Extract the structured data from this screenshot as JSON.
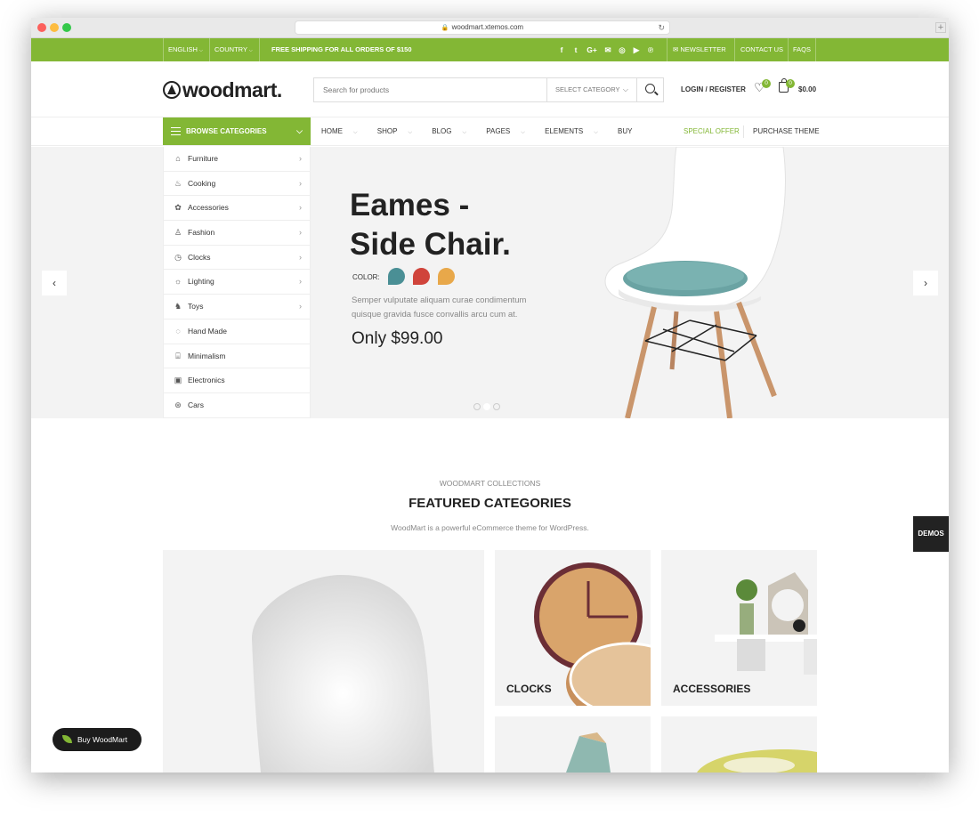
{
  "browser": {
    "url": "woodmart.xtemos.com"
  },
  "topbar": {
    "language": "ENGLISH",
    "country": "COUNTRY",
    "shipping": "FREE SHIPPING FOR ALL ORDERS OF $150",
    "socials": [
      "f",
      "t",
      "G+",
      "mail",
      "ig",
      "yt",
      "p"
    ],
    "newsletter": "NEWSLETTER",
    "contact": "CONTACT US",
    "faqs": "FAQS"
  },
  "header": {
    "logo": "woodmart.",
    "search_placeholder": "Search for products",
    "select_category": "SELECT CATEGORY",
    "login": "LOGIN / REGISTER",
    "wishlist_count": "0",
    "cart_count": "0",
    "cart_total": "$0.00"
  },
  "nav": {
    "browse": "BROWSE CATEGORIES",
    "items": [
      "HOME",
      "SHOP",
      "BLOG",
      "PAGES",
      "ELEMENTS",
      "BUY"
    ],
    "special_offer": "SPECIAL OFFER",
    "purchase": "PURCHASE THEME"
  },
  "categories": [
    "Furniture",
    "Cooking",
    "Accessories",
    "Fashion",
    "Clocks",
    "Lighting",
    "Toys",
    "Hand Made",
    "Minimalism",
    "Electronics",
    "Cars"
  ],
  "hero": {
    "title_line1": "Eames -",
    "title_line2": "Side Chair.",
    "color_label": "COLOR:",
    "swatches": [
      "#4a8f95",
      "#d0443b",
      "#e8a84a"
    ],
    "description": "Semper vulputate aliquam curae condimentum quisque gravida fusce convallis arcu cum at.",
    "price": "Only $99.00"
  },
  "featured": {
    "subtitle": "WOODMART COLLECTIONS",
    "title": "FEATURED CATEGORIES",
    "description": "WoodMart is a powerful eCommerce theme for WordPress.",
    "tiles": [
      "CLOCKS",
      "ACCESSORIES"
    ]
  },
  "demos": "DEMOS",
  "buy_button": "Buy WoodMart",
  "colors": {
    "brand": "#83b735"
  }
}
